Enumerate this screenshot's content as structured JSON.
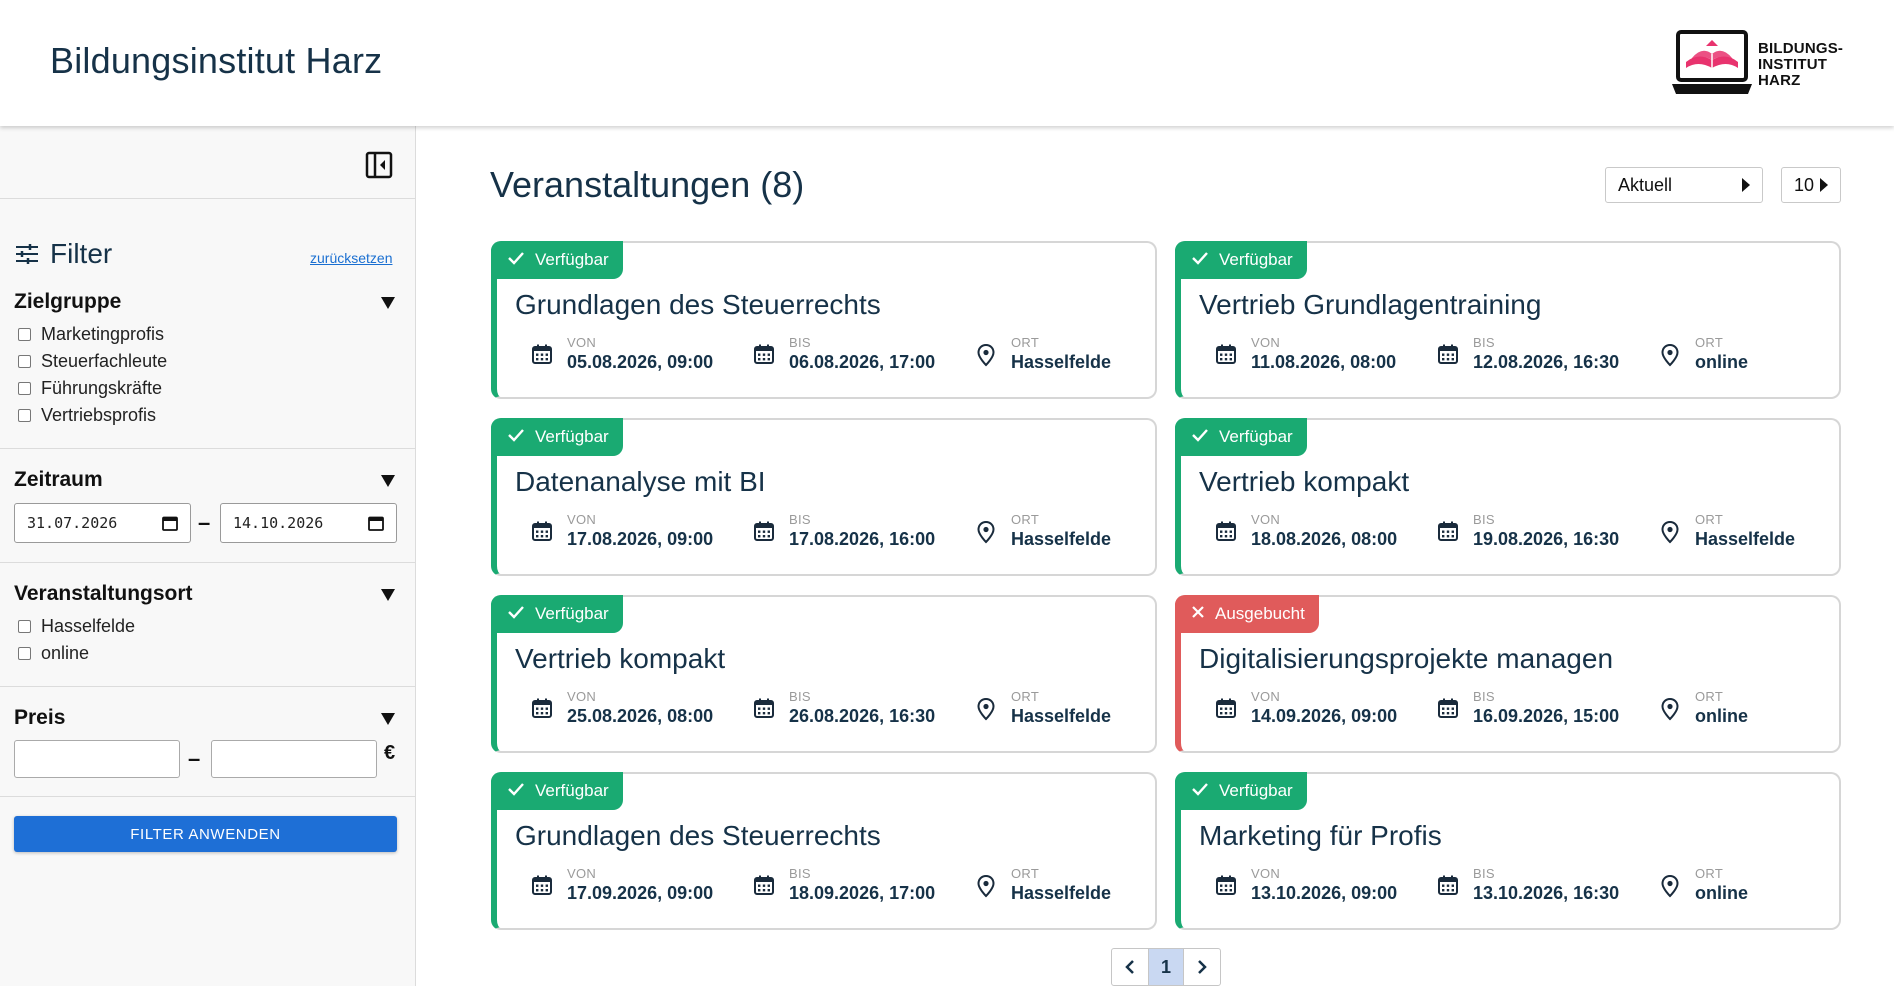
{
  "header": {
    "site_title": "Bildungsinstitut Harz",
    "logo_text_1": "BILDUNGS-",
    "logo_text_2": "INSTITUT",
    "logo_text_3": "HARZ",
    "logo_accent": "#e8336e"
  },
  "sidebar": {
    "filter_label": "Filter",
    "reset_label": "zurücksetzen",
    "zielgruppe": {
      "title": "Zielgruppe",
      "options": [
        "Marketingprofis",
        "Steuerfachleute",
        "Führungskräfte",
        "Vertriebsprofis"
      ]
    },
    "zeitraum": {
      "title": "Zeitraum",
      "from": "31.07.2026",
      "to": "14.10.2026",
      "separator": "–"
    },
    "ort": {
      "title": "Veranstaltungsort",
      "options": [
        "Hasselfelde",
        "online"
      ]
    },
    "preis": {
      "title": "Preis",
      "separator": "–",
      "currency": "€"
    },
    "apply_label": "FILTER ANWENDEN"
  },
  "main": {
    "title": "Veranstaltungen (8)",
    "sort_value": "Aktuell",
    "page_size": "10"
  },
  "labels": {
    "von": "VON",
    "bis": "BIS",
    "ort": "ORT"
  },
  "events": [
    {
      "status": "Verfügbar",
      "title": "Grundlagen des Steuerrechts",
      "von": "05.08.2026, 09:00",
      "bis": "06.08.2026, 17:00",
      "ort": "Hasselfelde"
    },
    {
      "status": "Verfügbar",
      "title": "Vertrieb Grundlagentraining",
      "von": "11.08.2026, 08:00",
      "bis": "12.08.2026, 16:30",
      "ort": "online"
    },
    {
      "status": "Verfügbar",
      "title": "Datenanalyse mit BI",
      "von": "17.08.2026, 09:00",
      "bis": "17.08.2026, 16:00",
      "ort": "Hasselfelde"
    },
    {
      "status": "Verfügbar",
      "title": "Vertrieb kompakt",
      "von": "18.08.2026, 08:00",
      "bis": "19.08.2026, 16:30",
      "ort": "Hasselfelde"
    },
    {
      "status": "Verfügbar",
      "title": "Vertrieb kompakt",
      "von": "25.08.2026, 08:00",
      "bis": "26.08.2026, 16:30",
      "ort": "Hasselfelde"
    },
    {
      "status": "Ausgebucht",
      "title": "Digitalisierungsprojekte managen",
      "von": "14.09.2026, 09:00",
      "bis": "16.09.2026, 15:00",
      "ort": "online"
    },
    {
      "status": "Verfügbar",
      "title": "Grundlagen des Steuerrechts",
      "von": "17.09.2026, 09:00",
      "bis": "18.09.2026, 17:00",
      "ort": "Hasselfelde"
    },
    {
      "status": "Verfügbar",
      "title": "Marketing für Profis",
      "von": "13.10.2026, 09:00",
      "bis": "13.10.2026, 16:30",
      "ort": "online"
    }
  ],
  "pagination": {
    "current": "1"
  },
  "colors": {
    "available": "#1aaa72",
    "booked": "#e05b5b",
    "primary": "#1e6fd6",
    "title": "#163248"
  }
}
